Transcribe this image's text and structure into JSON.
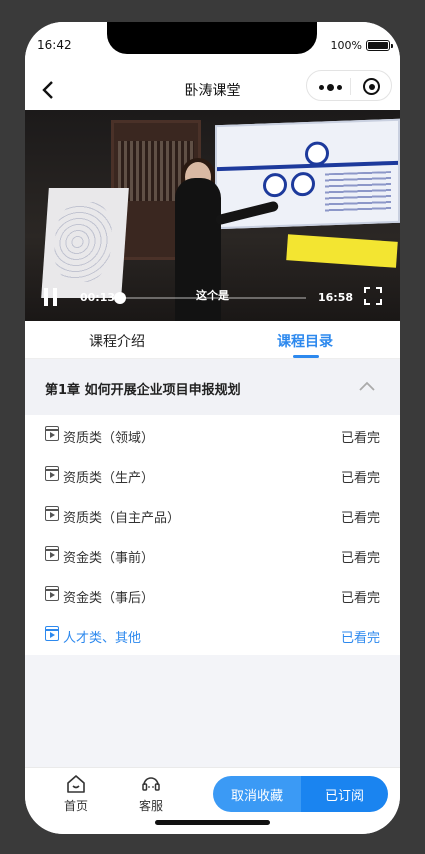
{
  "status_bar": {
    "time": "16:42",
    "battery": "100%"
  },
  "nav": {
    "title": "卧涛课堂"
  },
  "player": {
    "current_time": "00:13",
    "total_time": "16:58",
    "subtitle": "这个是",
    "progress": 0.013
  },
  "tabs": [
    {
      "label": "课程介绍",
      "active": false
    },
    {
      "label": "课程目录",
      "active": true
    }
  ],
  "chapter": {
    "title": "第1章  如何开展企业项目申报规划",
    "expanded": true
  },
  "lessons": [
    {
      "title": "资质类（领域）",
      "status": "已看完",
      "active": false
    },
    {
      "title": "资质类（生产）",
      "status": "已看完",
      "active": false
    },
    {
      "title": "资质类（自主产品）",
      "status": "已看完",
      "active": false
    },
    {
      "title": "资金类（事前）",
      "status": "已看完",
      "active": false
    },
    {
      "title": "资金类（事后）",
      "status": "已看完",
      "active": false
    },
    {
      "title": "人才类、其他",
      "status": "已看完",
      "active": true
    }
  ],
  "bottom": {
    "home_label": "首页",
    "service_label": "客服",
    "cancel_fav_label": "取消收藏",
    "subscribed_label": "已订阅"
  },
  "colors": {
    "accent": "#2d89ee",
    "button_left": "#3b9af5",
    "button_right": "#1a84f0"
  },
  "icons": [
    "back-icon",
    "more-dots-icon",
    "close-target-icon",
    "pause-icon",
    "fullscreen-icon",
    "chevron-up-icon",
    "video-lesson-icon",
    "home-icon",
    "headset-icon"
  ]
}
